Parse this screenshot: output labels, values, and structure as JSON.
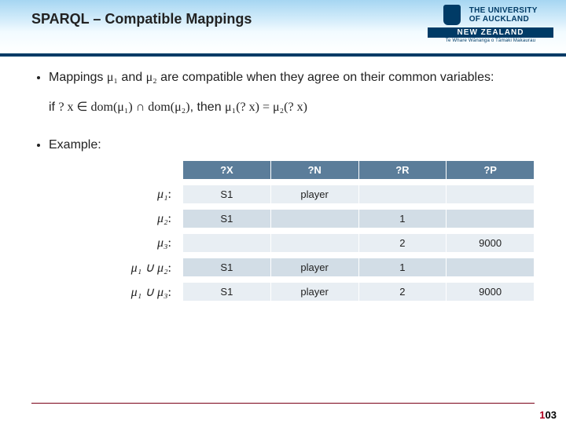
{
  "header": {
    "title": "SPARQL – Compatible Mappings",
    "logo": {
      "line1": "THE UNIVERSITY",
      "line2": "OF AUCKLAND",
      "bar": "NEW ZEALAND",
      "sub": "Te Whare Wānanga o Tāmaki Makaurau"
    }
  },
  "bullets": {
    "mappings_text_a": "Mappings ",
    "mappings_text_b": " and ",
    "mappings_text_c": " are compatible when they agree on their common variables:",
    "if_text_a": "if ",
    "if_text_b": ", then ",
    "example_label": "Example:"
  },
  "math": {
    "mu1": "μ₁",
    "mu2": "μ₂",
    "mu3": "μ₃",
    "cond": "? x ∈ dom(μ₁) ∩ dom(μ₂)",
    "eq": "μ₁(? x) = μ₂(? x)",
    "union12": "μ₁ ∪ μ₂",
    "union13": "μ₁ ∪ μ₃"
  },
  "table": {
    "headers": [
      "?X",
      "?N",
      "?R",
      "?P"
    ],
    "rows": [
      {
        "label_key": "mu1",
        "cells": [
          "S1",
          "player",
          "",
          ""
        ]
      },
      {
        "label_key": "mu2",
        "cells": [
          "S1",
          "",
          "1",
          ""
        ]
      },
      {
        "label_key": "mu3",
        "cells": [
          "",
          "",
          "2",
          "9000"
        ]
      },
      {
        "label_key": "union12",
        "cells": [
          "S1",
          "player",
          "1",
          ""
        ]
      },
      {
        "label_key": "union13",
        "cells": [
          "S1",
          "player",
          "2",
          "9000"
        ]
      }
    ]
  },
  "page": {
    "prefix": "1",
    "num": "03"
  }
}
